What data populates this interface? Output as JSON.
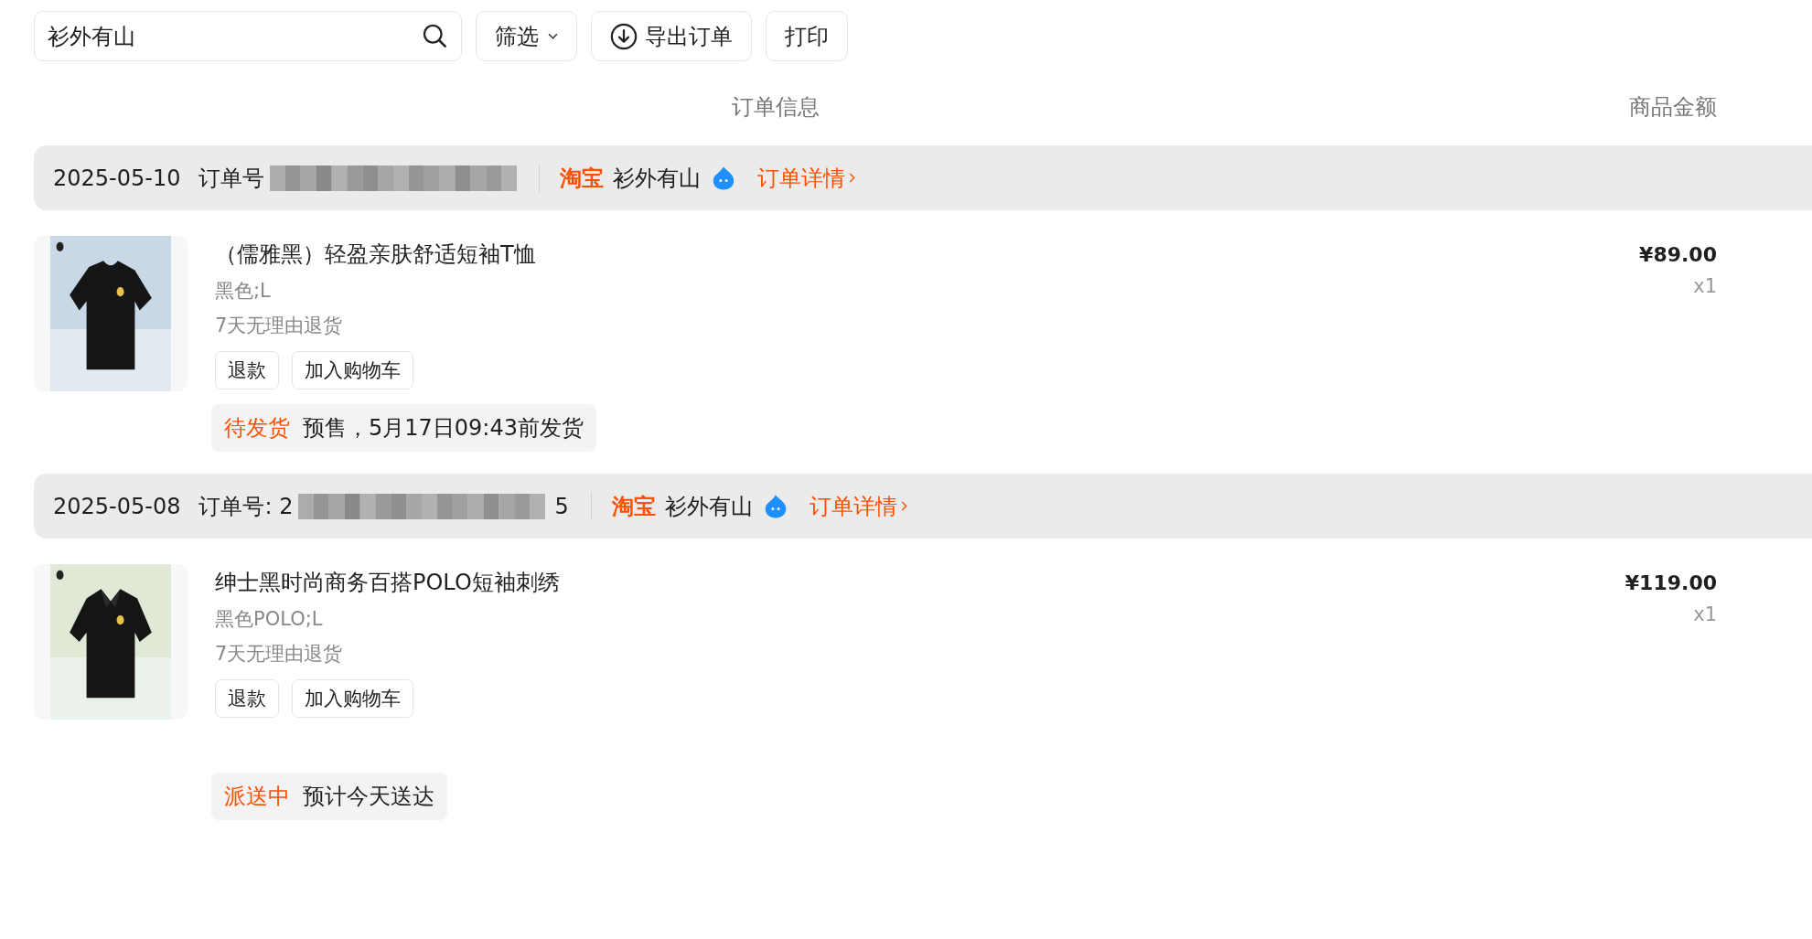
{
  "toolbar": {
    "search": {
      "value": "衫外有山"
    },
    "filter_button": "筛选",
    "export_button": "导出订单",
    "print_button": "打印"
  },
  "columns": {
    "order_info": "订单信息",
    "amount": "商品金额"
  },
  "orders": [
    {
      "date": "2025-05-10",
      "order_no_prefix": "订单号",
      "platform": "淘宝",
      "shop": "衫外有山",
      "detail_link": "订单详情",
      "items": [
        {
          "title": "（儒雅黑）轻盈亲肤舒适短袖T恤",
          "spec": "黑色;L",
          "policy": "7天无理由退货",
          "actions": [
            "退款",
            "加入购物车"
          ],
          "price": "¥89.00",
          "quantity": "x1"
        }
      ],
      "status": {
        "label": "待发货",
        "note": "预售，5月17日09:43前发货"
      }
    },
    {
      "date": "2025-05-08",
      "order_no_prefix": "订单号: 2",
      "order_no_suffix": "5",
      "platform": "淘宝",
      "shop": "衫外有山",
      "detail_link": "订单详情",
      "items": [
        {
          "title": "绅士黑时尚商务百搭POLO短袖刺绣",
          "spec": "黑色POLO;L",
          "policy": "7天无理由退货",
          "actions": [
            "退款",
            "加入购物车"
          ],
          "price": "¥119.00",
          "quantity": "x1"
        }
      ],
      "status": {
        "label": "派送中",
        "note": "预计今天送达"
      }
    }
  ]
}
